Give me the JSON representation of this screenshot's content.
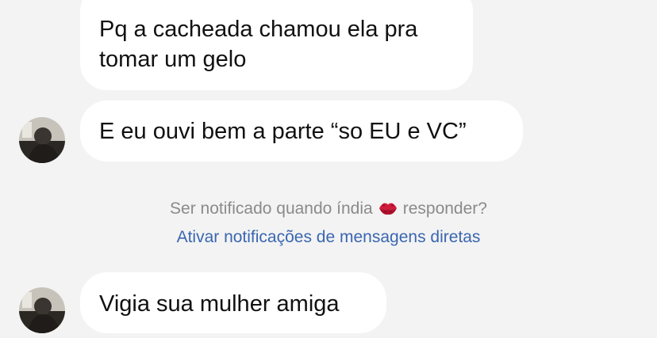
{
  "messages": [
    {
      "text_line1": "Pq a cacheada chamou ela pra",
      "text_line2": "tomar um gelo"
    },
    {
      "text": "E eu ouvi bem a parte “so EU e VC”"
    },
    {
      "text": "Vigia sua mulher amiga"
    }
  ],
  "notification": {
    "prompt_before": "Ser notificado quando índia",
    "prompt_after": "responder?",
    "emoji_icon": "kiss-mark-icon",
    "link": "Ativar notificações de mensagens diretas"
  },
  "colors": {
    "background": "#f3f3f3",
    "bubble": "#ffffff",
    "link": "#3a66b0",
    "muted_text": "#8a8a8a"
  }
}
